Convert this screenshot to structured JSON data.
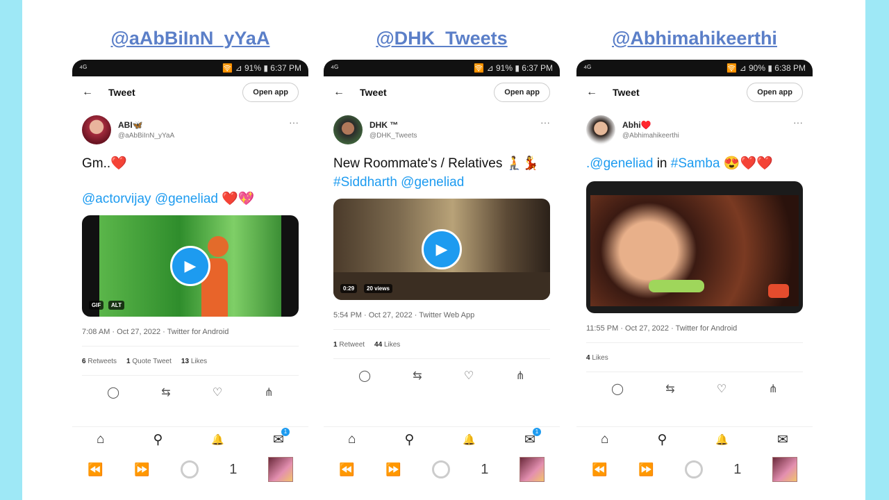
{
  "colors": {
    "background": "#9ee8f6",
    "handle": "#5b7fc8",
    "link": "#1d9bf0"
  },
  "phones": [
    {
      "handle": "@aAbBiInN_yYaA",
      "status_left": "⁴ᴳ",
      "status_right": "🛜 ⊿ 91% ▮ 6:37 PM",
      "back_icon": "←",
      "tweet_label": "Tweet",
      "open_app": "Open app",
      "author_name": "ABI🦋",
      "author_username": "@aAbBiInN_yYaA",
      "more_icon": "···",
      "line1": "Gm..❤️",
      "mentions": "@actorvijay @geneliad",
      "mentions_tail": " ❤️💖",
      "badge1": "GIF",
      "badge2": "ALT",
      "meta": "7:08 AM · Oct 27, 2022 · Twitter for Android",
      "stat1_num": "6",
      "stat1_label": "Retweets",
      "stat2_num": "1",
      "stat2_label": "Quote Tweet",
      "stat3_num": "13",
      "stat3_label": "Likes",
      "sys_num": "1"
    },
    {
      "handle": "@DHK_Tweets",
      "status_left": "⁴ᴳ",
      "status_right": "🛜 ⊿ 91% ▮ 6:37 PM",
      "back_icon": "←",
      "tweet_label": "Tweet",
      "open_app": "Open app",
      "author_name": "DHK ™",
      "author_username": "@DHK_Tweets",
      "more_icon": "···",
      "line1": "New Roommate's / Relatives 🧎💃",
      "hashtag": "#Siddharth",
      "mention": " @geneliad",
      "badge1": "0:29",
      "badge2": "20 views",
      "meta": "5:54 PM · Oct 27, 2022 · Twitter Web App",
      "stat1_num": "1",
      "stat1_label": "Retweet",
      "stat2_num": "44",
      "stat2_label": "Likes",
      "sys_num": "1"
    },
    {
      "handle": "@Abhimahikeerthi",
      "status_left": "⁴ᴳ",
      "status_right": "🛜 ⊿ 90% ▮ 6:38 PM",
      "back_icon": "←",
      "tweet_label": "Tweet",
      "open_app": "Open app",
      "author_name": "Abhi♥️",
      "author_username": "@Abhimahikeerthi",
      "more_icon": "···",
      "line1_prefix": ".@geneliad",
      "line1_mid": " in ",
      "line1_hashtag": "#Samba",
      "line1_tail": " 😍❤️❤️",
      "meta": "11:55 PM · Oct 27, 2022 · Twitter for Android",
      "stat1_num": "4",
      "stat1_label": "Likes",
      "sys_num": "1"
    }
  ],
  "icons": {
    "reply": "◯",
    "retweet": "⇆",
    "like": "♡",
    "share": "⋔",
    "home": "⌂",
    "search": "⚲",
    "bell": "🔔",
    "mail": "✉",
    "back_sys": "⏪",
    "forward_sys": "⏩"
  },
  "notify_count": "1"
}
